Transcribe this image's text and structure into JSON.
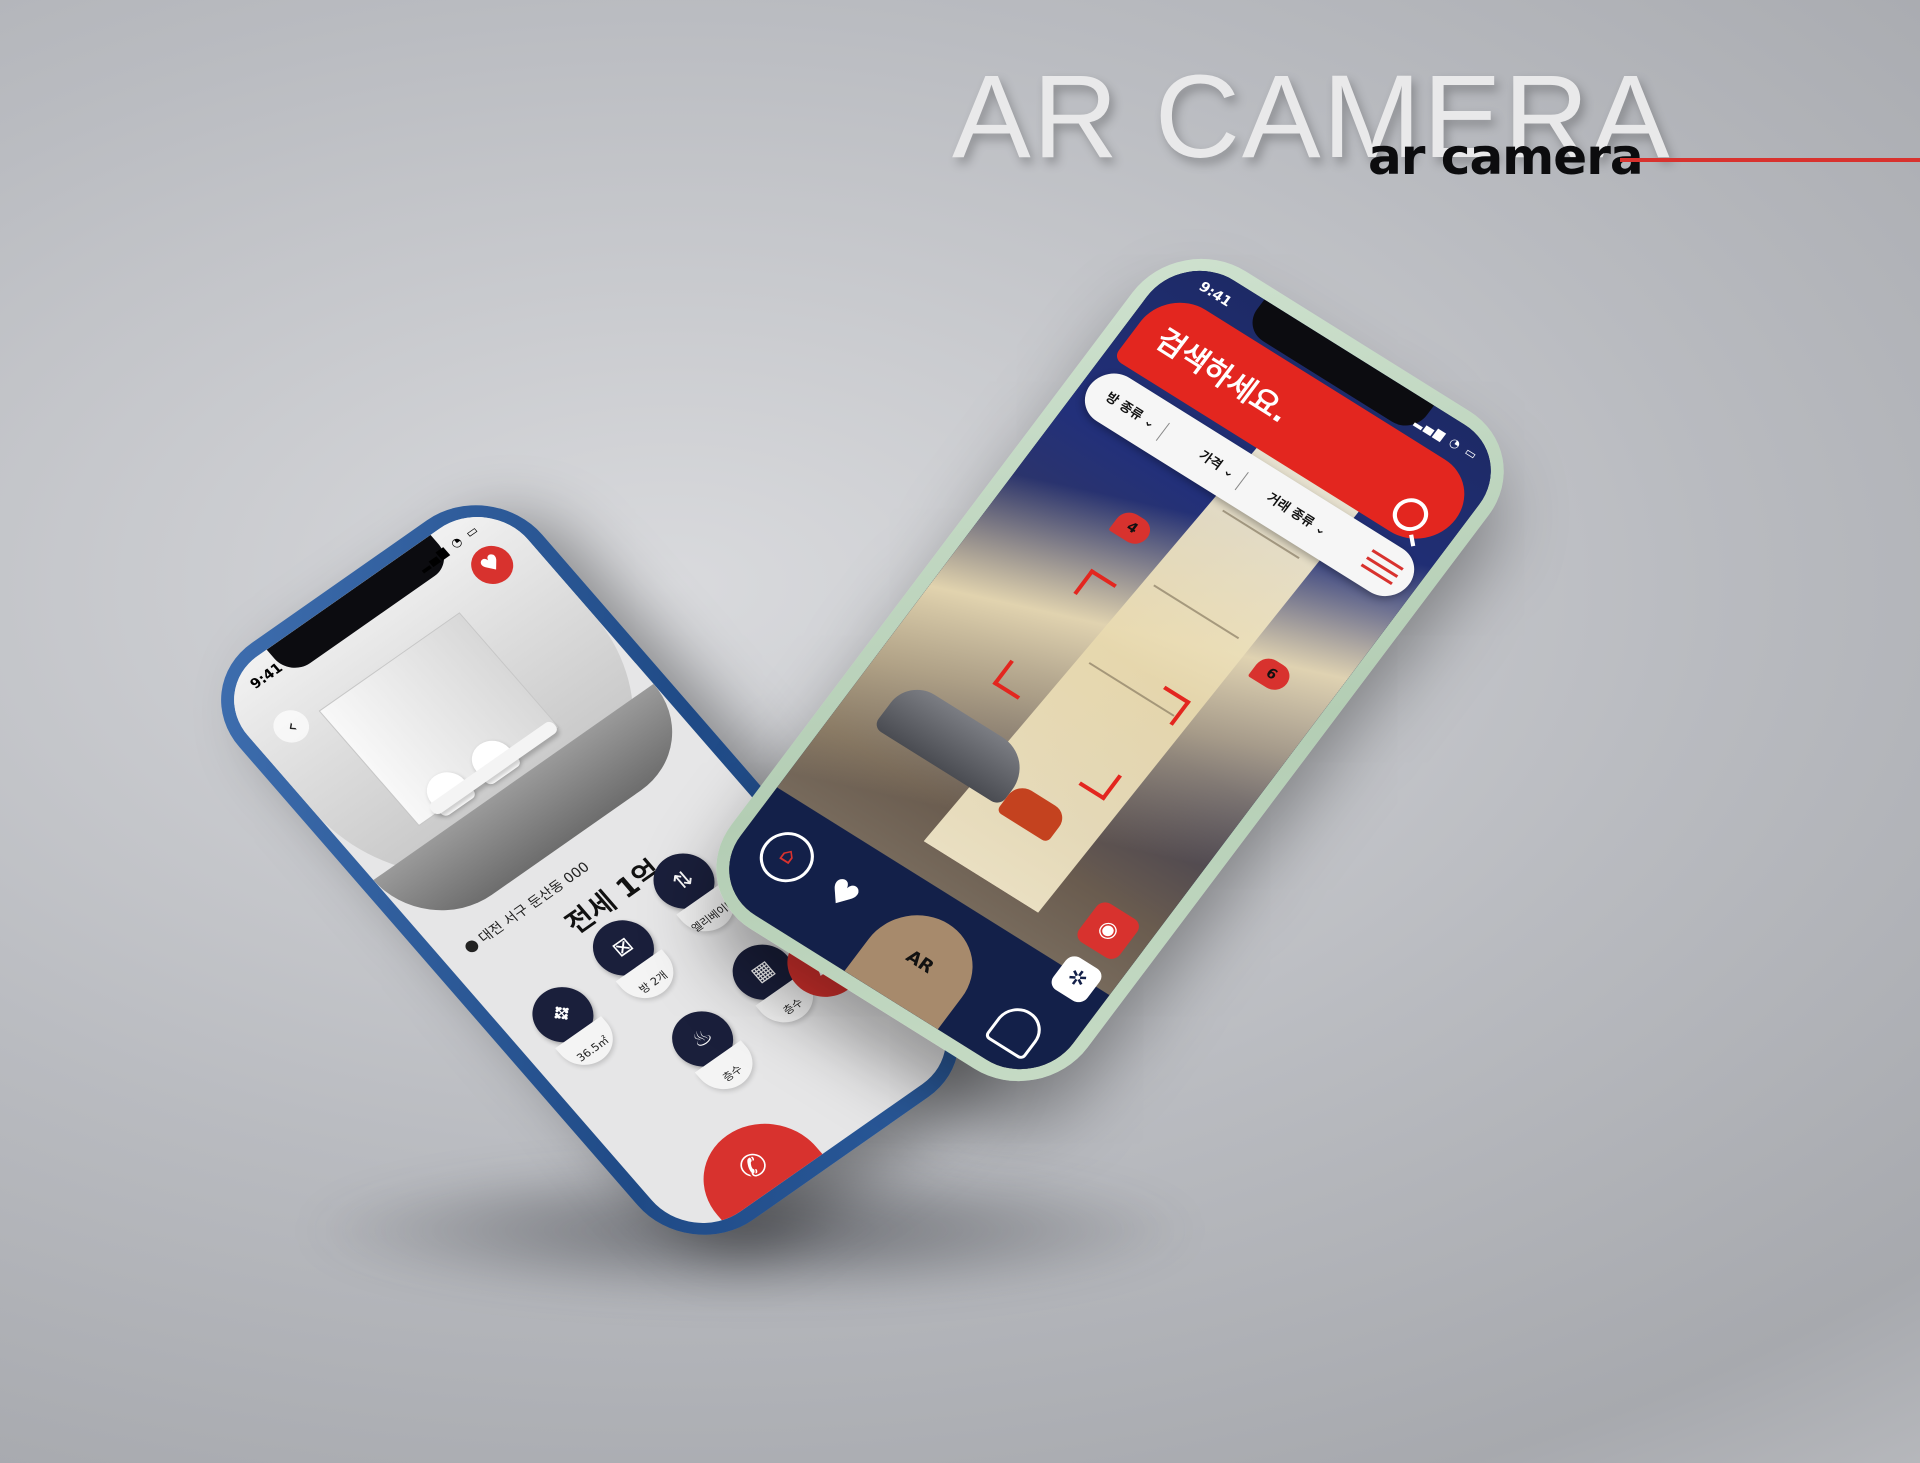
{
  "header": {
    "title": "AR CAMERA",
    "subtitle": "ar camera",
    "accent_color": "#d8322e"
  },
  "phone_back": {
    "status_time": "9:41",
    "address": "대전 서구 둔산동 000",
    "price": "전세 1억",
    "features": [
      {
        "icon": "area-icon",
        "label": "36.5㎡"
      },
      {
        "icon": "room-icon",
        "label": "방 2개"
      },
      {
        "icon": "elevator-icon",
        "label": "엘리베이터"
      },
      {
        "icon": "heating-icon",
        "label": "층수"
      },
      {
        "icon": "building-icon",
        "label": "층수"
      }
    ],
    "ar_button_label": "AR",
    "call_icon": "phone-icon",
    "heart_icon": "heart-icon",
    "back_icon": "back-icon"
  },
  "phone_front": {
    "status_time": "9:41",
    "search_placeholder": "검색하세요.",
    "filters": [
      "방 종류",
      "가격",
      "거래 종류"
    ],
    "pins": [
      "4",
      "6"
    ],
    "nav": {
      "ar_label": "AR",
      "home_icon": "home-icon",
      "favorites_icon": "heart-icon",
      "profile_icon": "profile-icon",
      "camera_icon": "camera-icon",
      "settings_icon": "gear-icon"
    }
  }
}
